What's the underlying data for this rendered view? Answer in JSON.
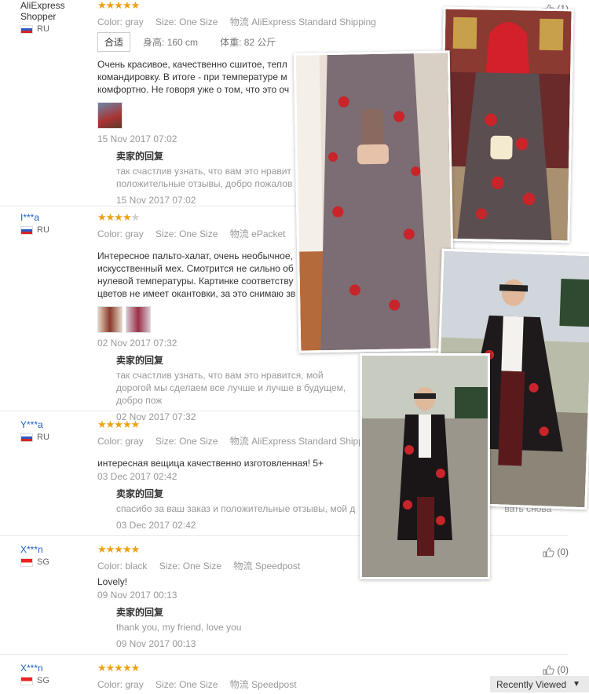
{
  "reviews": [
    {
      "user": "AliExpress Shopper",
      "country": "RU",
      "stars": 5,
      "color_label": "Color:",
      "color": "gray",
      "size_label": "Size:",
      "size": "One Size",
      "ship_label": "物流",
      "shipping": "AliExpress Standard Shipping",
      "fit_tag": "合适",
      "height_label": "身高:",
      "height": "160 cm",
      "weight_label": "体重:",
      "weight": "82 公斤",
      "text": "Очень красивое, качественно сшитое, тепл командировку. В итоге - при температуре м комфортно. Не говоря уже о том, что это оч",
      "date": "15 Nov 2017 07:02",
      "reply_title": "卖家的回复",
      "reply_text": "так счастлив узнать, что вам это нравит положительные отзывы, добро пожалов",
      "reply_date": "15 Nov 2017 07:02",
      "helpful": "(1)"
    },
    {
      "user": "I***a",
      "country": "RU",
      "stars": 4,
      "color_label": "Color:",
      "color": "gray",
      "size_label": "Size:",
      "size": "One Size",
      "ship_label": "物流",
      "shipping": "ePacket",
      "text": "Интересное пальто-халат, очень необычное, искусственный мех. Смотрится не сильно об нулевой температуры. Картинке соответству цветов не имеет окантовки, за это снимаю зв",
      "date": "02 Nov 2017 07:32",
      "reply_title": "卖家的回复",
      "reply_text": "так счастлив узнать, что вам это нравится, мой дорогой мы сделаем все лучше и лучше в будущем, добро пож",
      "reply_date": "02 Nov 2017 07:32"
    },
    {
      "user": "Y***a",
      "country": "RU",
      "stars": 5,
      "color_label": "Color:",
      "color": "gray",
      "size_label": "Size:",
      "size": "One Size",
      "ship_label": "物流",
      "shipping": "AliExpress Standard Shippin",
      "text": "интересная вещица качественно изготовленная! 5+",
      "date": "03 Dec 2017 02:42",
      "reply_title": "卖家的回复",
      "reply_text": "спасибо за ваш заказ и положительные отзывы, мой д",
      "reply_text_tail": "вать снова",
      "reply_date": "03 Dec 2017 02:42"
    },
    {
      "user": "X***n",
      "country": "SG",
      "stars": 5,
      "color_label": "Color:",
      "color": "black",
      "size_label": "Size:",
      "size": "One Size",
      "ship_label": "物流",
      "shipping": "Speedpost",
      "text": "Lovely!",
      "date": "09 Nov 2017 00:13",
      "reply_title": "卖家的回复",
      "reply_text": "thank you, my friend, love you",
      "reply_date": "09 Nov 2017 00:13",
      "helpful": "(0)"
    },
    {
      "user": "X***n",
      "country": "SG",
      "stars": 5,
      "color_label": "Color:",
      "color": "gray",
      "size_label": "Size:",
      "size": "One Size",
      "ship_label": "物流",
      "shipping": "Speedpost",
      "helpful": "(0)"
    }
  ],
  "recently_viewed": "Recently Viewed",
  "colors": {
    "link": "#1e61c4",
    "star": "#f0a012",
    "coat_red": "#c8242a"
  }
}
